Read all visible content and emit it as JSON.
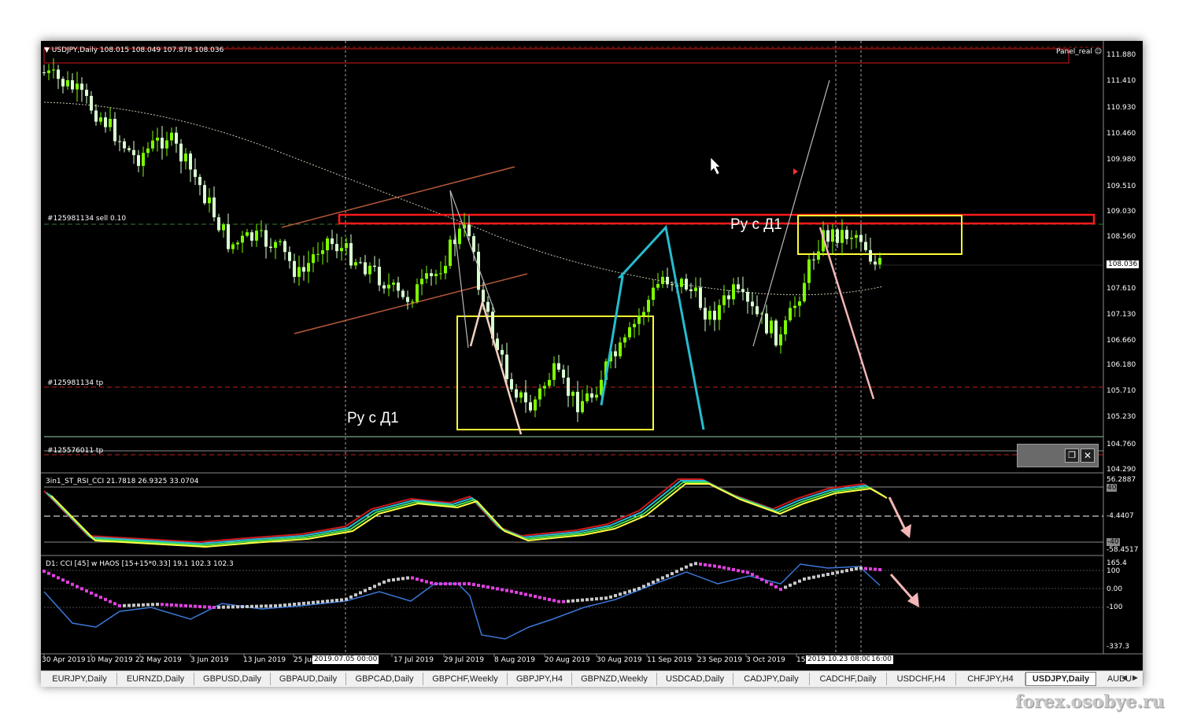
{
  "chart_header": {
    "symbol_info": "USDJPY,Daily  108.015 108.049 107.878 108.036",
    "panel_label": "Panel_real"
  },
  "price_scale": [
    "111.880",
    "111.410",
    "110.930",
    "110.460",
    "109.980",
    "109.510",
    "109.030",
    "108.560",
    "108.036",
    "107.610",
    "107.130",
    "106.660",
    "106.180",
    "105.710",
    "105.230",
    "104.760",
    "104.290"
  ],
  "order_labels": {
    "sell_order": "#125981134 sell 0.10",
    "tp1": "#125981134 tp",
    "tp2": "#125576011 tp"
  },
  "annotations": {
    "left_note": "Ру с Д1",
    "right_note": "Ру с Д1"
  },
  "indicator1": {
    "label": "3in1_ST_RSI_CCI 21.7818 26.9325 33.0704",
    "scale": [
      "56.2887",
      "40",
      "-4.4407",
      "-40",
      "-58.4517"
    ]
  },
  "indicator2": {
    "label": "D1: CCI [45] w HAOS [15+15*0.33] 19.1 102.3 102.3",
    "scale": [
      "165.4",
      "100",
      "0.00",
      "-100",
      "-337.3"
    ]
  },
  "date_axis": [
    "30 Apr 2019",
    "10 May 2019",
    "22 May 2019",
    "3 Jun 2019",
    "13 Jun 2019",
    "25 Jun 2019",
    "17 Jul 2019",
    "29 Jul 2019",
    "8 Aug 2019",
    "20 Aug 2019",
    "30 Aug 2019",
    "11 Sep 2019",
    "23 Sep 2019",
    "3 Oct 2019",
    "15"
  ],
  "crosshair_dates": {
    "left": "2019.07.05 00:00",
    "right": "2019.10.23 08:00",
    "right2": "16:00"
  },
  "tabs": [
    "EURJPY,Daily",
    "EURNZD,Daily",
    "GBPUSD,Daily",
    "GBPAUD,Daily",
    "GBPCAD,Daily",
    "GBPCHF,Weekly",
    "GBPJPY,H4",
    "GBPNZD,Weekly",
    "USDCAD,Daily",
    "CADJPY,Daily",
    "CADCHF,Daily",
    "USDCHF,H4",
    "CHFJPY,H4",
    "USDJPY,Daily",
    "AUDU"
  ],
  "active_tab": "USDJPY,Daily",
  "watermark": "forex.osobye.ru",
  "colors": {
    "bull_candle": "#7CFC00",
    "bear_candle": "#d8ffd0",
    "resistance_box": "#ff1a1a",
    "range_box": "#ffff33",
    "channel": "#b4593a",
    "zigzag": "#27bcd0",
    "projection": "#f4b6b6"
  },
  "icons": [
    "dropdown-arrow-icon",
    "smiley-icon",
    "cursor-arrow-icon",
    "restore-window-icon",
    "close-icon",
    "tab-scroll-left-icon",
    "tab-scroll-right-icon"
  ]
}
